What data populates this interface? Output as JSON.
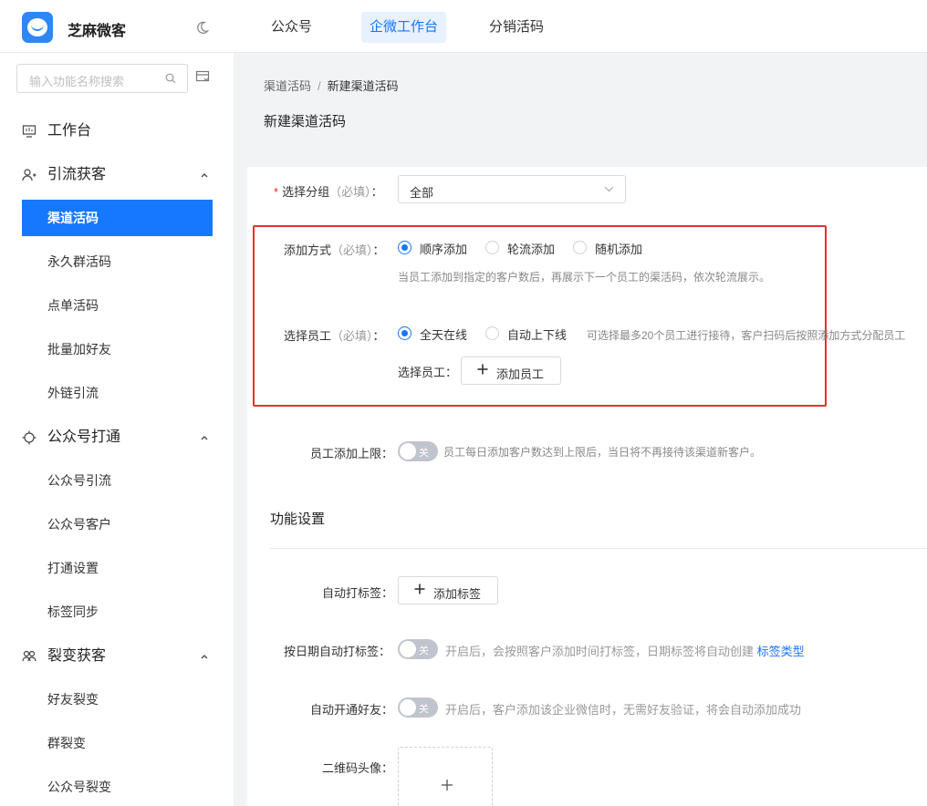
{
  "header": {
    "brand": "芝麻微客",
    "nav": [
      {
        "label": "公众号",
        "active": false
      },
      {
        "label": "企微工作台",
        "active": true
      },
      {
        "label": "分销活码",
        "active": false
      }
    ]
  },
  "sidebar": {
    "search_placeholder": "输入功能名称搜索",
    "workbench": "工作台",
    "groups": [
      {
        "label": "引流获客",
        "items": [
          "渠道活码",
          "永久群活码",
          "点单活码",
          "批量加好友",
          "外链引流"
        ]
      },
      {
        "label": "公众号打通",
        "items": [
          "公众号引流",
          "公众号客户",
          "打通设置",
          "标签同步"
        ]
      },
      {
        "label": "裂变获客",
        "items": [
          "好友裂变",
          "群裂变",
          "公众号裂变"
        ]
      }
    ],
    "active_item": "渠道活码"
  },
  "breadcrumb": {
    "parent": "渠道活码",
    "sep": "/",
    "current": "新建渠道活码"
  },
  "page_title": "新建渠道活码",
  "form": {
    "group": {
      "required_mark": "*",
      "label": "选择分组",
      "note": "（必填）",
      "colon": "：",
      "value": "全部"
    },
    "add_method": {
      "label": "添加方式",
      "note": "（必填）",
      "colon": "：",
      "options": [
        "顺序添加",
        "轮流添加",
        "随机添加"
      ],
      "selected": "顺序添加",
      "hint": "当员工添加到指定的客户数后，再展示下一个员工的渠活码，依次轮流展示。"
    },
    "staff": {
      "label": "选择员工",
      "note": "（必填）",
      "colon": "：",
      "options": [
        "全天在线",
        "自动上下线"
      ],
      "selected": "全天在线",
      "hint": "可选择最多20个员工进行接待，客户扫码后按照添加方式分配员工",
      "sub_label": "选择员工：",
      "add_button": "添加员工"
    },
    "limit": {
      "label": "员工添加上限：",
      "switch_text": "关",
      "hint": "员工每日添加客户数达到上限后，当日将不再接待该渠道新客户。"
    }
  },
  "features": {
    "section_title": "功能设置",
    "auto_tag": {
      "label": "自动打标签：",
      "button": "添加标签"
    },
    "date_tag": {
      "label": "按日期自动打标签：",
      "switch_text": "关",
      "hint": "开启后，会按照客户添加时间打标签，日期标签将自动创建",
      "link": "标签类型"
    },
    "auto_friend": {
      "label": "自动开通好友：",
      "switch_text": "关",
      "hint": "开启后，客户添加该企业微信时，无需好友验证，将会自动添加成功"
    },
    "qr_avatar": {
      "label": "二维码头像："
    }
  },
  "colors": {
    "primary": "#1677ff",
    "highlight_box": "#e8302e",
    "required": "#f5222d"
  }
}
